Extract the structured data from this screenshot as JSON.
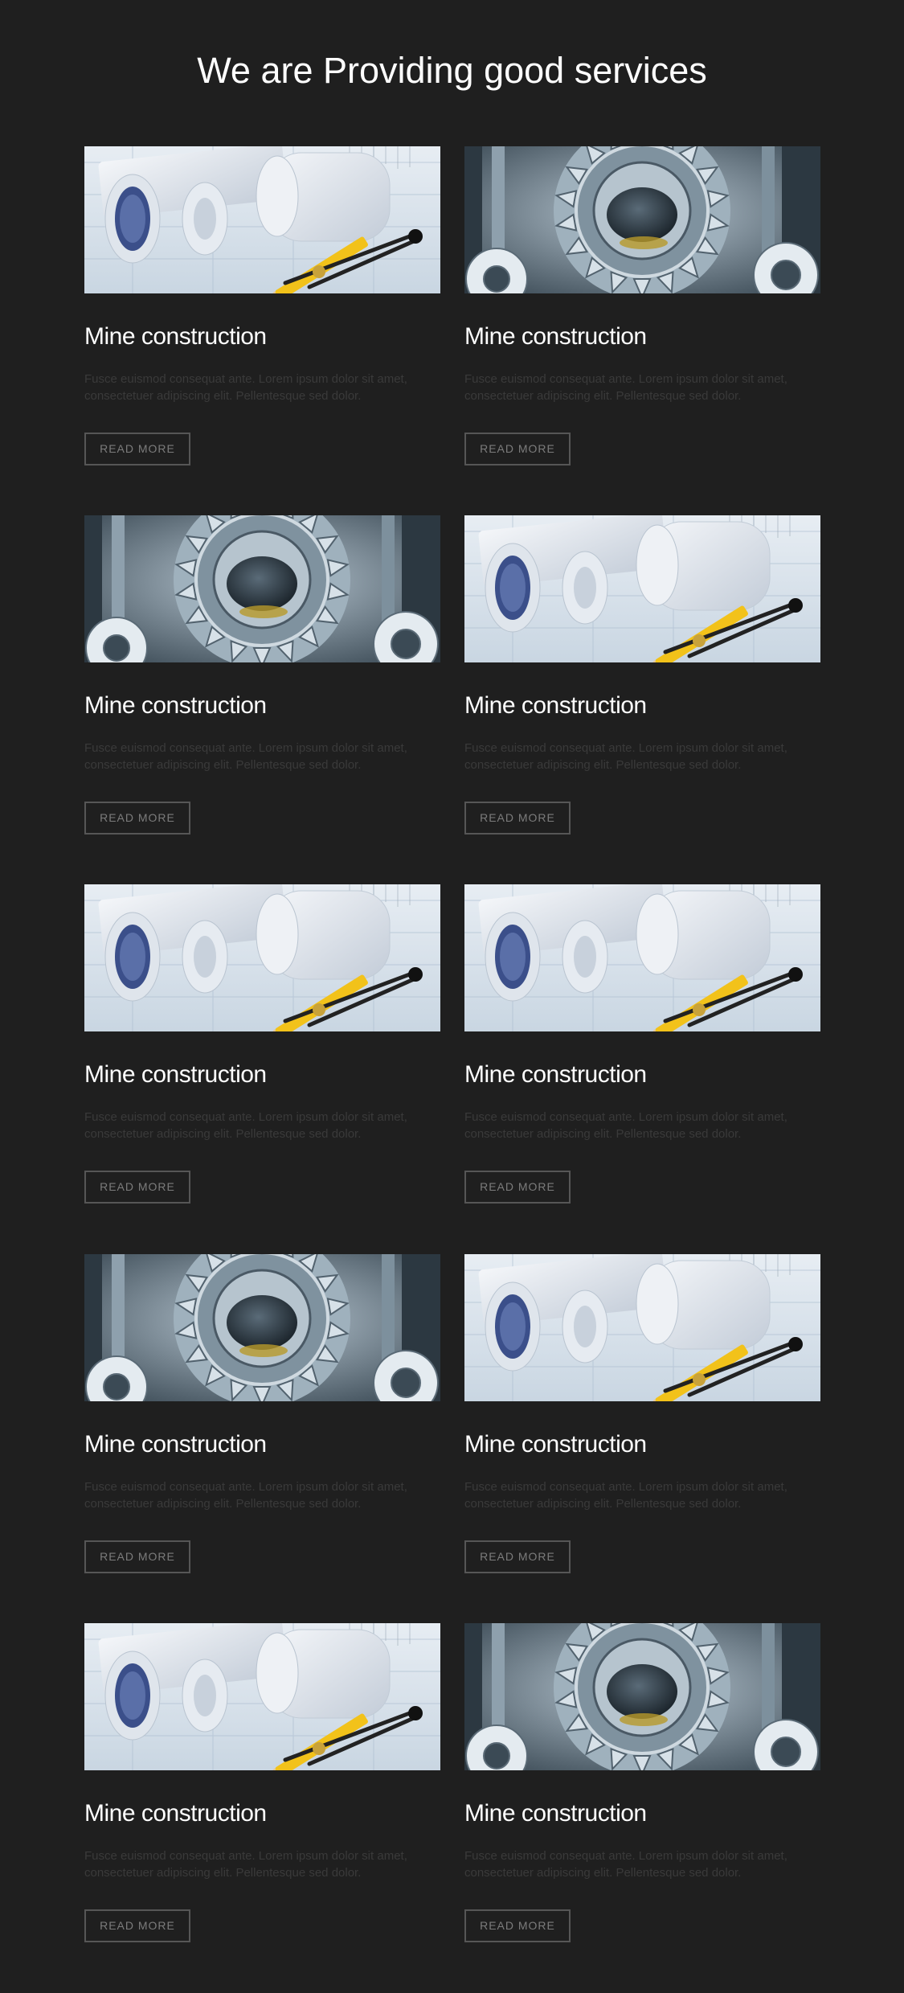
{
  "section": {
    "title": "We are Providing good services"
  },
  "cards": [
    {
      "image": "blueprints-photo",
      "title": "Mine construction",
      "text": "Fusce euismod consequat ante. Lorem ipsum dolor sit amet, consectetuer adipiscing elit. Pellentesque sed dolor.",
      "button": "READ MORE"
    },
    {
      "image": "gears-photo",
      "title": "Mine construction",
      "text": "Fusce euismod consequat ante. Lorem ipsum dolor sit amet, consectetuer adipiscing elit. Pellentesque sed dolor.",
      "button": "READ MORE"
    },
    {
      "image": "gears-photo",
      "title": "Mine construction",
      "text": "Fusce euismod consequat ante. Lorem ipsum dolor sit amet, consectetuer adipiscing elit. Pellentesque sed dolor.",
      "button": "READ MORE"
    },
    {
      "image": "blueprints-photo",
      "title": "Mine construction",
      "text": "Fusce euismod consequat ante. Lorem ipsum dolor sit amet, consectetuer adipiscing elit. Pellentesque sed dolor.",
      "button": "READ MORE"
    },
    {
      "image": "blueprints-photo",
      "title": "Mine construction",
      "text": "Fusce euismod consequat ante. Lorem ipsum dolor sit amet, consectetuer adipiscing elit. Pellentesque sed dolor.",
      "button": "READ MORE"
    },
    {
      "image": "blueprints-photo",
      "title": "Mine construction",
      "text": "Fusce euismod consequat ante. Lorem ipsum dolor sit amet, consectetuer adipiscing elit. Pellentesque sed dolor.",
      "button": "READ MORE"
    },
    {
      "image": "gears-photo",
      "title": "Mine construction",
      "text": "Fusce euismod consequat ante. Lorem ipsum dolor sit amet, consectetuer adipiscing elit. Pellentesque sed dolor.",
      "button": "READ MORE"
    },
    {
      "image": "blueprints-photo",
      "title": "Mine construction",
      "text": "Fusce euismod consequat ante. Lorem ipsum dolor sit amet, consectetuer adipiscing elit. Pellentesque sed dolor.",
      "button": "READ MORE"
    },
    {
      "image": "blueprints-photo",
      "title": "Mine construction",
      "text": "Fusce euismod consequat ante. Lorem ipsum dolor sit amet, consectetuer adipiscing elit. Pellentesque sed dolor.",
      "button": "READ MORE"
    },
    {
      "image": "gears-photo",
      "title": "Mine construction",
      "text": "Fusce euismod consequat ante. Lorem ipsum dolor sit amet, consectetuer adipiscing elit. Pellentesque sed dolor.",
      "button": "READ MORE"
    }
  ],
  "colors": {
    "background": "#1f1f1f",
    "title": "#ffffff",
    "body_text": "#3a3a3a",
    "button_border": "#565656",
    "button_text": "#7c7c7c"
  }
}
